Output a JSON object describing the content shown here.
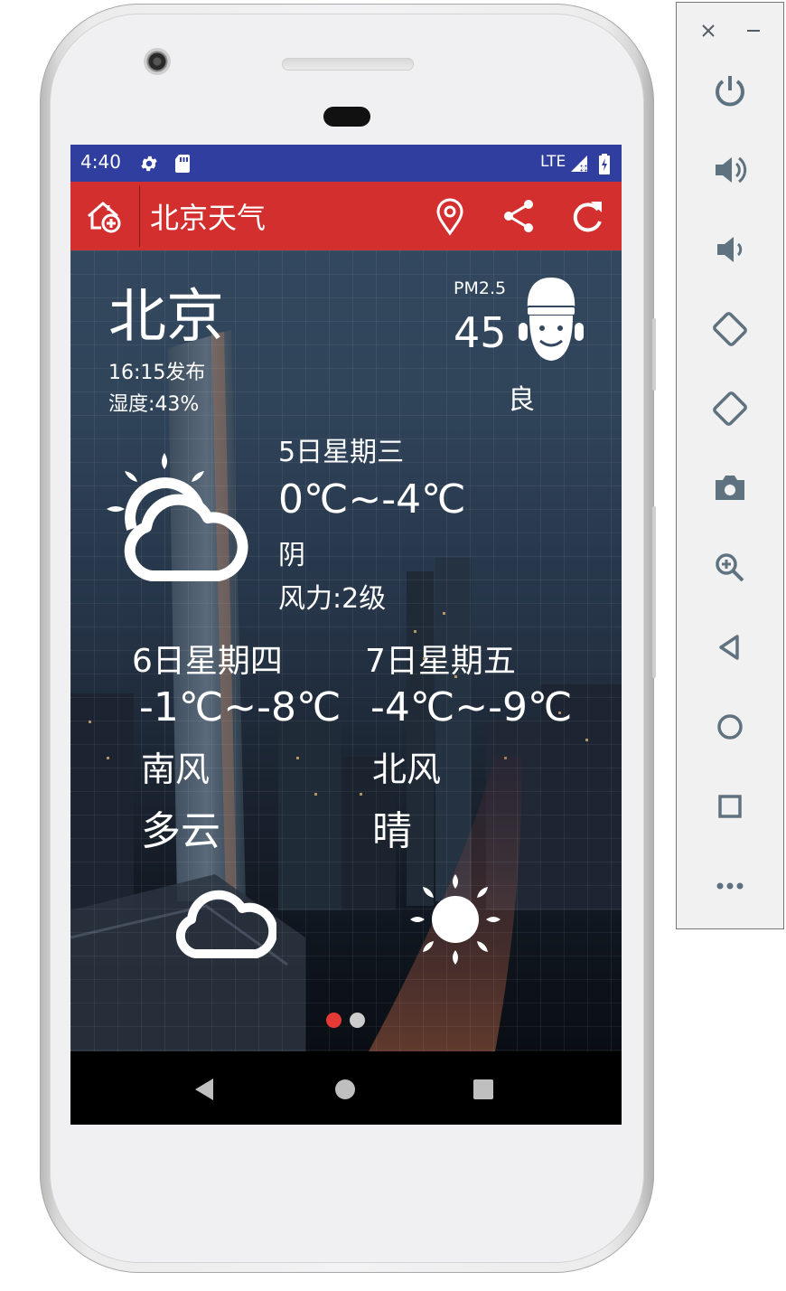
{
  "status_bar": {
    "time": "4:40",
    "network": "LTE",
    "icons": [
      "gear-icon",
      "sd-card-icon",
      "signal-icon",
      "battery-charging-icon"
    ]
  },
  "toolbar": {
    "title": "北京天气",
    "color": "#d32f2f",
    "buttons": [
      "add-city-icon",
      "location-pin-icon",
      "share-icon",
      "refresh-icon"
    ]
  },
  "current": {
    "city": "北京",
    "publish_time": "16:15发布",
    "humidity": "湿度:43%",
    "pm_label": "PM2.5",
    "pm_value": "45",
    "pm_level": "良",
    "pm_icon": "smiling-face-icon"
  },
  "today": {
    "date": "5日星期三",
    "temp": "0℃~-4℃",
    "condition": "阴",
    "wind": "风力:2级",
    "icon": "partly-cloudy-icon"
  },
  "forecast": [
    {
      "date": "6日星期四",
      "temp": "-1℃~-8℃",
      "wind": "南风",
      "condition": "多云",
      "icon": "cloud-icon"
    },
    {
      "date": "7日星期五",
      "temp": "-4℃~-9℃",
      "wind": "北风",
      "condition": "晴",
      "icon": "sun-icon"
    }
  ],
  "pager": {
    "active_color": "#e53935",
    "inactive_color": "#cccccc",
    "current_page": 1,
    "pages": 2
  },
  "emulator_panel": {
    "icons": [
      "close-icon",
      "minimize-icon",
      "power-icon",
      "volume-up-icon",
      "volume-down-icon",
      "rotate-left-icon",
      "rotate-right-icon",
      "camera-icon",
      "zoom-icon",
      "back-icon",
      "home-icon",
      "overview-icon",
      "more-icon"
    ]
  }
}
